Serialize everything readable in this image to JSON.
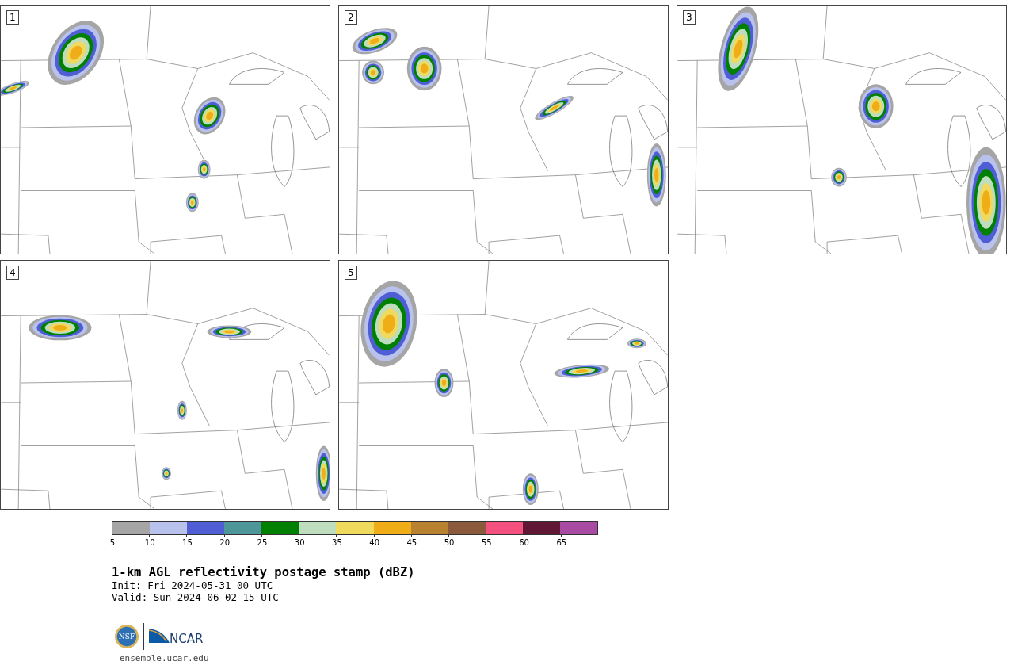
{
  "panels": [
    {
      "label": "1"
    },
    {
      "label": "2"
    },
    {
      "label": "3"
    },
    {
      "label": "4"
    },
    {
      "label": "5"
    }
  ],
  "colorbar": {
    "segments": [
      {
        "label": "5",
        "color": "#a5a5a5"
      },
      {
        "label": "10",
        "color": "#b8c2ec"
      },
      {
        "label": "15",
        "color": "#505ed6"
      },
      {
        "label": "20",
        "color": "#4f969b"
      },
      {
        "label": "25",
        "color": "#008000"
      },
      {
        "label": "30",
        "color": "#bedcbe"
      },
      {
        "label": "35",
        "color": "#f0da5e"
      },
      {
        "label": "40",
        "color": "#efad18"
      },
      {
        "label": "45",
        "color": "#b98231"
      },
      {
        "label": "50",
        "color": "#8b5a3d"
      },
      {
        "label": "55",
        "color": "#f45180"
      },
      {
        "label": "60",
        "color": "#611634"
      },
      {
        "label": "65",
        "color": "#a94aa3"
      }
    ]
  },
  "title": "1-km AGL reflectivity postage stamp (dBZ)",
  "init": " Init: Fri 2024-05-31 00 UTC",
  "valid": "Valid: Sun 2024-06-02 15 UTC",
  "logo": {
    "left": "NSF",
    "right": "NCAR"
  },
  "url": "ensemble.ucar.edu"
}
